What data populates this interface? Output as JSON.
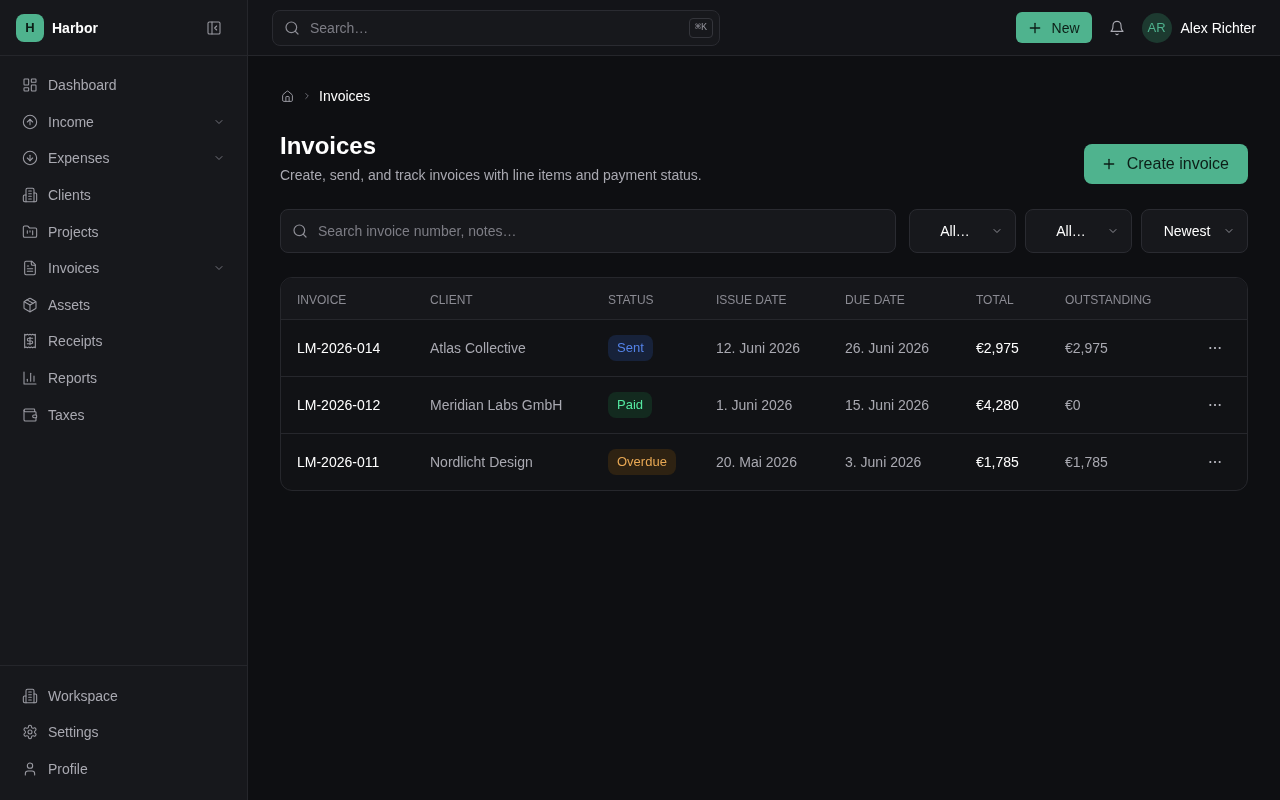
{
  "sidebar": {
    "brand": {
      "initial": "H",
      "name": "Harbor"
    },
    "nav_items": [
      {
        "label": "Dashboard",
        "kind": "link"
      },
      {
        "label": "Income",
        "kind": "group"
      },
      {
        "label": "Expenses",
        "kind": "group"
      },
      {
        "label": "Clients",
        "kind": "link"
      },
      {
        "label": "Projects",
        "kind": "link"
      },
      {
        "label": "Invoices",
        "kind": "group"
      },
      {
        "label": "Assets",
        "kind": "link"
      },
      {
        "label": "Receipts",
        "kind": "link"
      },
      {
        "label": "Reports",
        "kind": "link"
      },
      {
        "label": "Taxes",
        "kind": "link"
      }
    ],
    "footer_items": [
      {
        "label": "Workspace"
      },
      {
        "label": "Settings"
      },
      {
        "label": "Profile"
      }
    ]
  },
  "topbar": {
    "search": {
      "placeholder": "Search…",
      "shortcut": "⌘K"
    },
    "new_button": "New",
    "user": {
      "initials": "AR",
      "name": "Alex Richter"
    }
  },
  "breadcrumb": {
    "current": "Invoices"
  },
  "page": {
    "title": "Invoices",
    "subtitle": "Create, send, and track invoices with line items and payment status.",
    "create_button": "Create invoice"
  },
  "filters": {
    "search": {
      "placeholder": "Search invoice number, notes…"
    },
    "selects": [
      {
        "value": "All…"
      },
      {
        "value": "All…"
      },
      {
        "value": "Newest"
      }
    ]
  },
  "table": {
    "columns": [
      "INVOICE",
      "CLIENT",
      "STATUS",
      "ISSUE DATE",
      "DUE DATE",
      "TOTAL",
      "OUTSTANDING"
    ],
    "rows": [
      {
        "invoice": "LM-2026-014",
        "client": "Atlas Collective",
        "status": {
          "label": "Sent",
          "color": "#17223a"
        },
        "issue_date": "12. Juni 2026",
        "due_date": "26. Juni 2026",
        "total": "€2,975",
        "outstanding": "€2,975"
      },
      {
        "invoice": "LM-2026-012",
        "client": "Meridian Labs GmbH",
        "status": {
          "label": "Paid",
          "color": "#132a1f"
        },
        "issue_date": "1. Juni 2026",
        "due_date": "15. Juni 2026",
        "total": "€4,280",
        "outstanding": "€0"
      },
      {
        "invoice": "LM-2026-011",
        "client": "Nordlicht Design",
        "status": {
          "label": "Overdue",
          "color": "#2e2212"
        },
        "issue_date": "20. Mai 2026",
        "due_date": "3. Juni 2026",
        "total": "€1,785",
        "outstanding": "€1,785"
      }
    ]
  }
}
